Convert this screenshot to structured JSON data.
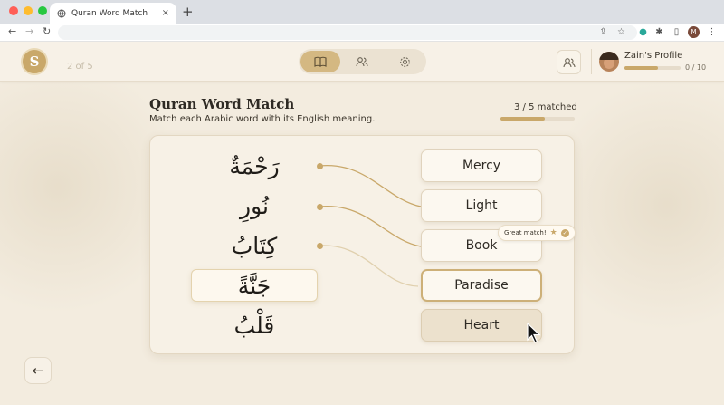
{
  "browser": {
    "tab_title": "Quran Word Match",
    "tab_close": "×",
    "new_tab": "+",
    "profile_initial": "M"
  },
  "header": {
    "logo_letter": "S",
    "pager": "2 of 5",
    "profile_name": "Zain's Profile",
    "profile_progress": 0.6,
    "profile_count": "0 / 10",
    "nav": [
      {
        "icon": "book-icon",
        "active": true
      },
      {
        "icon": "users-icon",
        "active": false
      },
      {
        "icon": "gear-icon",
        "active": false
      }
    ]
  },
  "game": {
    "title": "Quran Word Match",
    "subtitle": "Match each Arabic word with its English meaning.",
    "matched_text": "3 / 5 matched",
    "matched_progress": 0.6,
    "arabic_words": [
      "رَحْمَةٌ",
      "نُورِ",
      "كِتَابُ",
      "جَنَّةً",
      "قَلْبُ"
    ],
    "selected_arabic_index": 3,
    "answers": [
      "Mercy",
      "Light",
      "Book",
      "Paradise",
      "Heart"
    ],
    "highlighted_answer_index": 3,
    "hovered_answer_index": 4,
    "tooltip": "Great match!"
  },
  "colors": {
    "accent": "#c9a86a",
    "background": "#f3ecdf"
  },
  "back_button": "←"
}
